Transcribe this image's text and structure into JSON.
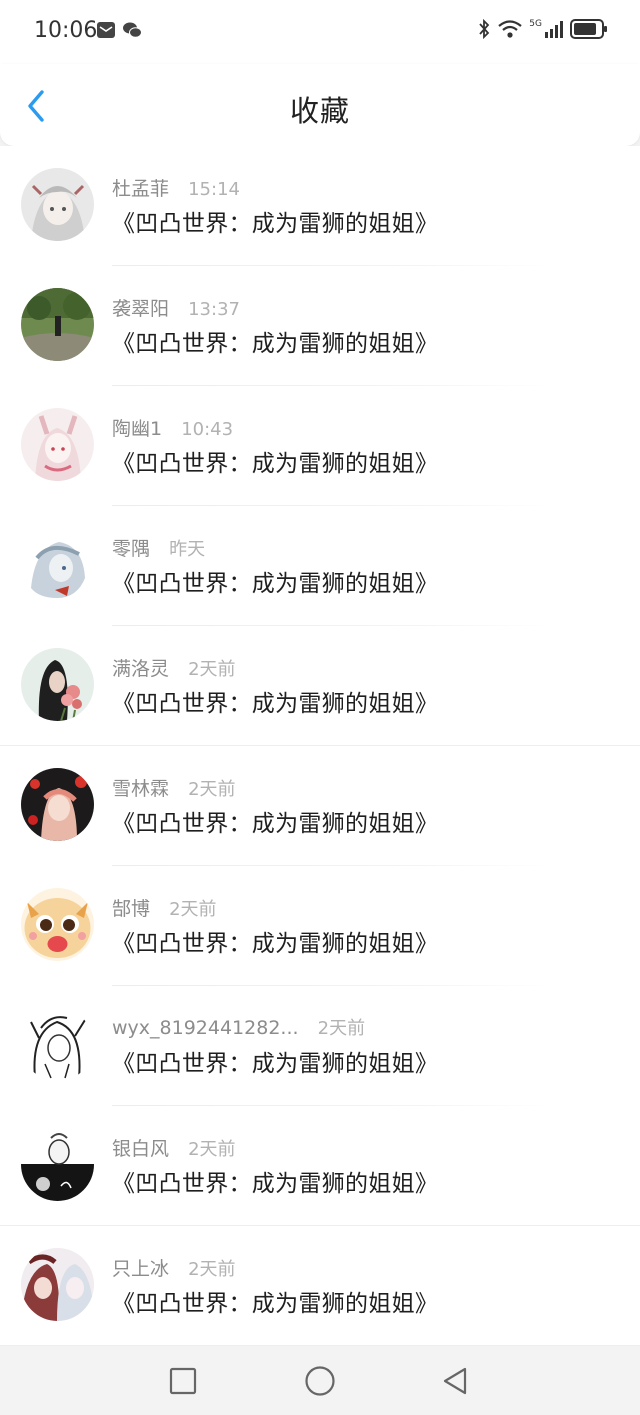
{
  "status_bar": {
    "time": "10:06",
    "left_icons": [
      "mail-icon",
      "wechat-icon"
    ],
    "right_icons": [
      "bluetooth-icon",
      "wifi-icon",
      "5g-signal-icon",
      "battery-icon"
    ],
    "network_label": "5G"
  },
  "header": {
    "title": "收藏",
    "back_icon": "chevron-left-icon",
    "accent_color": "#2b9bf0"
  },
  "favorites": [
    {
      "name": "杜孟菲",
      "time": "15:14",
      "title": "《凹凸世界：成为雷狮的姐姐》"
    },
    {
      "name": "袭翠阳",
      "time": "13:37",
      "title": "《凹凸世界：成为雷狮的姐姐》"
    },
    {
      "name": "陶幽1",
      "time": "10:43",
      "title": "《凹凸世界：成为雷狮的姐姐》"
    },
    {
      "name": "零隅",
      "time": "昨天",
      "title": "《凹凸世界：成为雷狮的姐姐》"
    },
    {
      "name": "满洛灵",
      "time": "2天前",
      "title": "《凹凸世界：成为雷狮的姐姐》"
    },
    {
      "name": "雪林霖",
      "time": "2天前",
      "title": "《凹凸世界：成为雷狮的姐姐》"
    },
    {
      "name": "郜博",
      "time": "2天前",
      "title": "《凹凸世界：成为雷狮的姐姐》"
    },
    {
      "name": "wyx_8192441282...",
      "time": "2天前",
      "title": "《凹凸世界：成为雷狮的姐姐》"
    },
    {
      "name": "银白风",
      "time": "2天前",
      "title": "《凹凸世界：成为雷狮的姐姐》"
    },
    {
      "name": "只上冰",
      "time": "2天前",
      "title": "《凹凸世界：成为雷狮的姐姐》"
    }
  ],
  "nav_bar": {
    "buttons": [
      "recent-apps-square-icon",
      "home-circle-icon",
      "back-triangle-icon"
    ]
  }
}
